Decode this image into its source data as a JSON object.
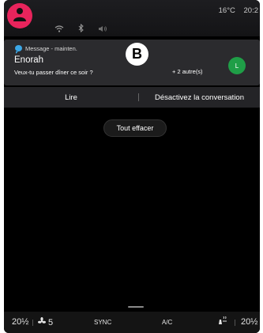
{
  "status": {
    "temperature": "16°C",
    "time": "20:2"
  },
  "icons": {
    "profile": "person-icon",
    "wifi": "wifi-icon",
    "bluetooth": "bluetooth-icon",
    "volume": "volume-icon",
    "message": "message-bubble-icon",
    "fan": "fan-icon",
    "seat_heat": "seat-heat-icon"
  },
  "notification": {
    "app_label": "Message - mainten.",
    "sender": "Enorah",
    "preview": "Veux-tu passer dîner ce soir ?",
    "others": "+ 2 autre(s)",
    "contact_initial": "L"
  },
  "marker": "B",
  "actions": {
    "read": "Lire",
    "mute": "Désactivez la conversation"
  },
  "clear_all": "Tout effacer",
  "climate": {
    "left_temp": "20½",
    "fan_speed": "5",
    "sync": "SYNC",
    "ac": "A/C",
    "right_temp": "20½"
  },
  "colors": {
    "avatar": "#e8245c",
    "message_icon": "#3ba7e6",
    "contact_avatar": "#1f9e47",
    "card": "#2b2b2e",
    "background": "#000000"
  }
}
